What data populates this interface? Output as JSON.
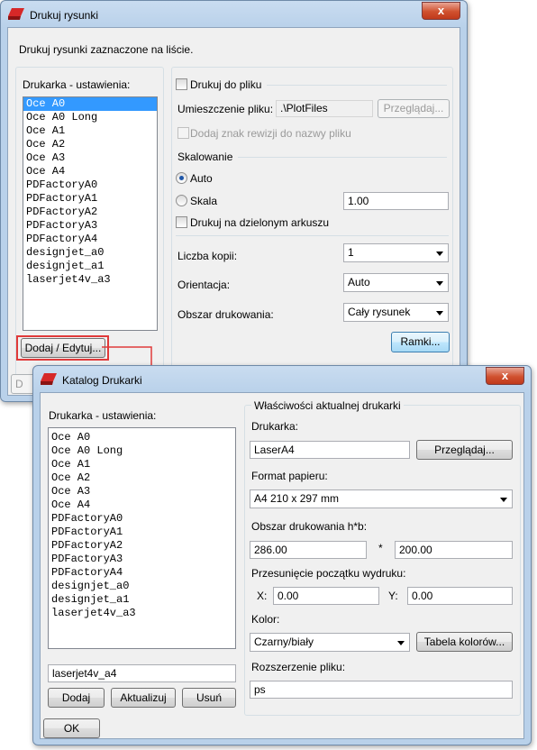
{
  "dialog1": {
    "title": "Drukuj rysunki",
    "close_label": "x",
    "description": "Drukuj rysunki zaznaczone na liście.",
    "printer_settings_label": "Drukarka - ustawienia:",
    "printers": [
      "Oce A0",
      "Oce A0 Long",
      "Oce A1",
      "Oce A2",
      "Oce A3",
      "Oce A4",
      "PDFactoryA0",
      "PDFactoryA1",
      "PDFactoryA2",
      "PDFactoryA3",
      "PDFactoryA4",
      "designjet_a0",
      "designjet_a1",
      "laserjet4v_a3"
    ],
    "selected_printer": "Oce A0",
    "add_edit_button": "Dodaj / Edytuj...",
    "hidden_button_prefix": "D",
    "print_to_file": "Drukuj do pliku",
    "file_location_label": "Umieszczenie pliku:",
    "file_location_value": ".\\PlotFiles",
    "browse_button": "Przeglądaj...",
    "add_revision_mark": "Dodaj znak rewizji do nazwy pliku",
    "scaling_label": "Skalowanie",
    "auto_label": "Auto",
    "scale_label": "Skala",
    "scale_value": "1.00",
    "print_split_sheet": "Drukuj na dzielonym arkuszu",
    "copies_label": "Liczba kopii:",
    "copies_value": "1",
    "orientation_label": "Orientacja:",
    "orientation_value": "Auto",
    "print_area_label": "Obszar drukowania:",
    "print_area_value": "Cały rysunek",
    "frames_button": "Ramki..."
  },
  "dialog2": {
    "title": "Katalog Drukarki",
    "close_label": "x",
    "printer_settings_label": "Drukarka - ustawienia:",
    "printers": [
      "Oce A0",
      "Oce A0 Long",
      "Oce A1",
      "Oce A2",
      "Oce A3",
      "Oce A4",
      "PDFactoryA0",
      "PDFactoryA1",
      "PDFactoryA2",
      "PDFactoryA3",
      "PDFactoryA4",
      "designjet_a0",
      "designjet_a1",
      "laserjet4v_a3"
    ],
    "name_field": "laserjet4v_a4",
    "add_button": "Dodaj",
    "update_button": "Aktualizuj",
    "remove_button": "Usuń",
    "ok_button": "OK",
    "properties_group": "Właściwości aktualnej drukarki",
    "printer_label": "Drukarka:",
    "printer_value": "LaserA4",
    "browse_button": "Przeglądaj...",
    "paper_format_label": "Format papieru:",
    "paper_format_value": "A4 210 x 297 mm",
    "print_area_label": "Obszar drukowania h*b:",
    "height_value": "286.00",
    "times_sign": "*",
    "width_value": "200.00",
    "offset_label": "Przesunięcie początku wydruku:",
    "x_label": "X:",
    "x_value": "0.00",
    "y_label": "Y:",
    "y_value": "0.00",
    "color_label": "Kolor:",
    "color_value": "Czarny/biały",
    "color_table_button": "Tabela kolorów...",
    "extension_label": "Rozszerzenie pliku:",
    "extension_value": "ps"
  },
  "colors": {
    "highlight": "#e03a3a",
    "selection": "#3399ff",
    "radio_dot": "#1e56a8"
  }
}
